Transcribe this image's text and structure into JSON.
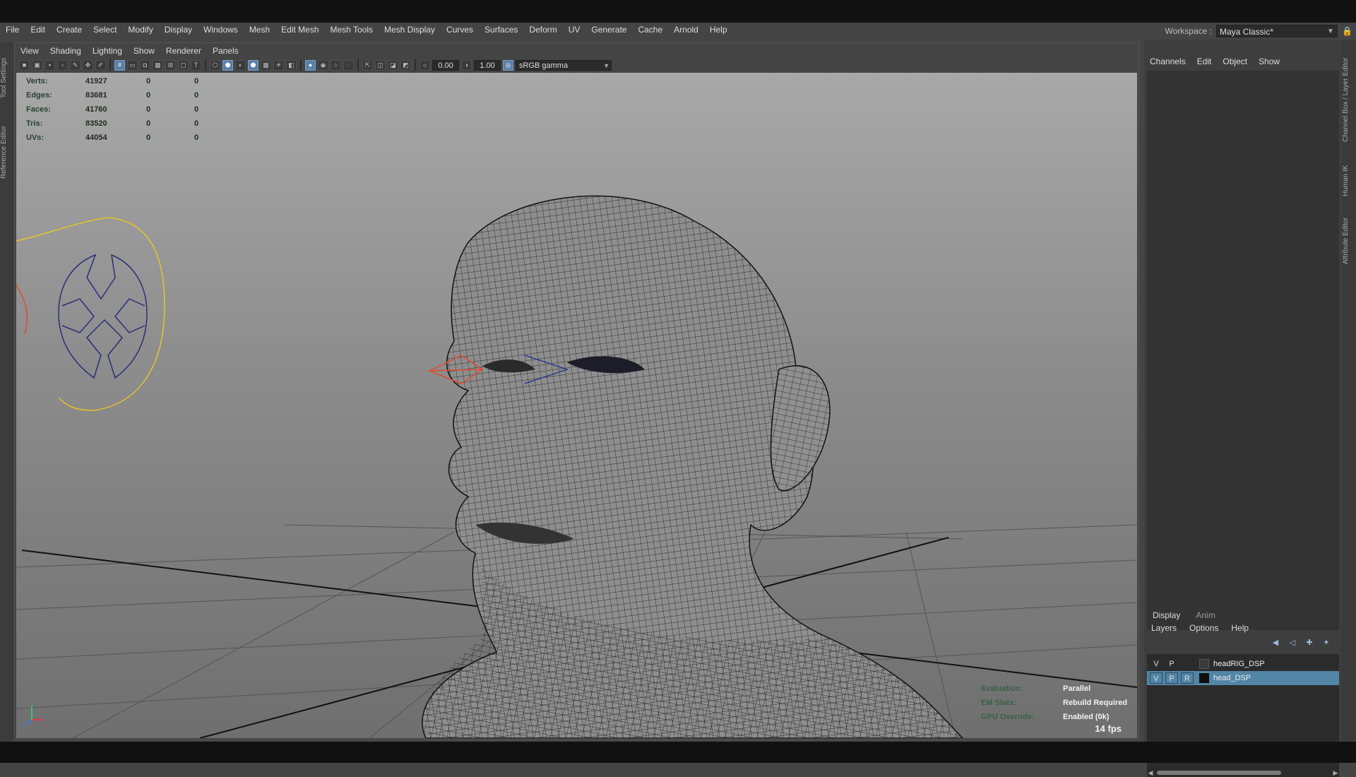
{
  "menubar": {
    "items": [
      "File",
      "Edit",
      "Create",
      "Select",
      "Modify",
      "Display",
      "Windows",
      "Mesh",
      "Edit Mesh",
      "Mesh Tools",
      "Mesh Display",
      "Curves",
      "Surfaces",
      "Deform",
      "UV",
      "Generate",
      "Cache",
      "Arnold",
      "Help"
    ]
  },
  "workspace": {
    "label": "Workspace :",
    "value": "Maya Classic*"
  },
  "left_tabs": [
    "Tool Settings",
    "Reference Editor"
  ],
  "right_tabs": [
    "Channel Box / Layer Editor",
    "Human IK",
    "Attribute Editor"
  ],
  "panel_menu": [
    "View",
    "Shading",
    "Lighting",
    "Show",
    "Renderer",
    "Panels"
  ],
  "toolbar": {
    "exposure": "0.00",
    "gamma": "1.00",
    "color_space": "sRGB gamma"
  },
  "hud": {
    "rows": [
      {
        "label": "Verts:",
        "value": "41927",
        "sel": "0",
        "comp": "0"
      },
      {
        "label": "Edges:",
        "value": "83681",
        "sel": "0",
        "comp": "0"
      },
      {
        "label": "Faces:",
        "value": "41760",
        "sel": "0",
        "comp": "0"
      },
      {
        "label": "Tris:",
        "value": "83520",
        "sel": "0",
        "comp": "0"
      },
      {
        "label": "UVs:",
        "value": "44054",
        "sel": "0",
        "comp": "0"
      }
    ]
  },
  "hud_eval": {
    "rows": [
      {
        "label": "Evaluation:",
        "value": "Parallel"
      },
      {
        "label": "EM Stats:",
        "value": "Rebuild Required"
      },
      {
        "label": "GPU Override:",
        "value": "Enabled (0k)"
      }
    ]
  },
  "fps": "14 fps",
  "channel_box": {
    "menu": [
      "Channels",
      "Edit",
      "Object",
      "Show"
    ]
  },
  "layer_editor": {
    "tabs": [
      "Display",
      "Anim"
    ],
    "menu": [
      "Layers",
      "Options",
      "Help"
    ],
    "layers": [
      {
        "v": "V",
        "p": "P",
        "r": "",
        "name": "headRIG_DSP",
        "color": "#3a3a3a",
        "selected": false
      },
      {
        "v": "V",
        "p": "P",
        "r": "R",
        "name": "head_DSP",
        "color": "#101010",
        "selected": true
      }
    ]
  },
  "colors": {
    "accent": "#5285a6",
    "viewport_top": "#a8a8a8",
    "viewport_bottom": "#6f6f6f",
    "wire": "#111111"
  }
}
